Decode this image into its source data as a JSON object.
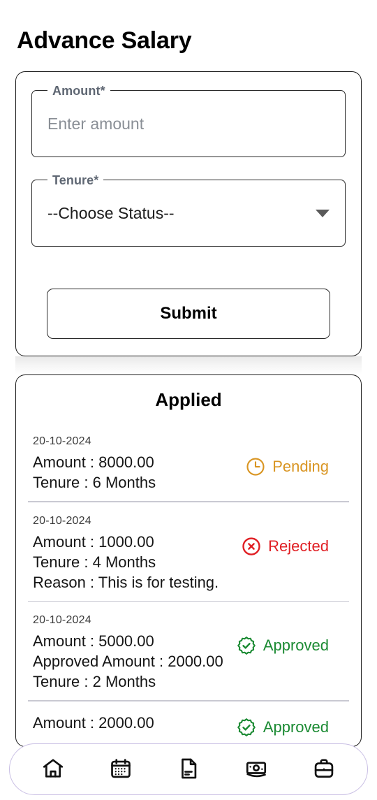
{
  "page": {
    "title": "Advance Salary"
  },
  "form": {
    "amount_field": {
      "label": "Amount*",
      "placeholder": "Enter amount",
      "value": ""
    },
    "tenure_field": {
      "label": "Tenure*",
      "value": "--Choose Status--",
      "caret_icon": "chevron-down-icon"
    },
    "submit_label": "Submit"
  },
  "applied": {
    "title": "Applied",
    "entries": [
      {
        "date": "20-10-2024",
        "lines": [
          "Amount : 8000.00",
          "Tenure : 6 Months"
        ],
        "status": "Pending",
        "status_color": "#d99522",
        "status_icon": "clock-icon"
      },
      {
        "date": "20-10-2024",
        "lines": [
          "Amount : 1000.00",
          "Tenure : 4 Months",
          "Reason : This is for testing."
        ],
        "status": "Rejected",
        "status_color": "#e01e23",
        "status_icon": "circle-x-icon"
      },
      {
        "date": "20-10-2024",
        "lines": [
          "Amount : 5000.00",
          "Approved Amount : 2000.00",
          "Tenure : 2 Months"
        ],
        "status": "Approved",
        "status_color": "#1a8a32",
        "status_icon": "badge-check-icon"
      },
      {
        "date": "",
        "lines": [
          "Amount : 2000.00"
        ],
        "status": "Approved",
        "status_color": "#1a8a32",
        "status_icon": "badge-check-icon"
      }
    ]
  },
  "bottom_nav": {
    "items": [
      {
        "name": "home",
        "icon": "home-icon"
      },
      {
        "name": "calendar",
        "icon": "calendar-icon"
      },
      {
        "name": "document",
        "icon": "document-icon"
      },
      {
        "name": "payroll",
        "icon": "banknote-icon"
      },
      {
        "name": "briefcase",
        "icon": "briefcase-icon"
      }
    ]
  }
}
